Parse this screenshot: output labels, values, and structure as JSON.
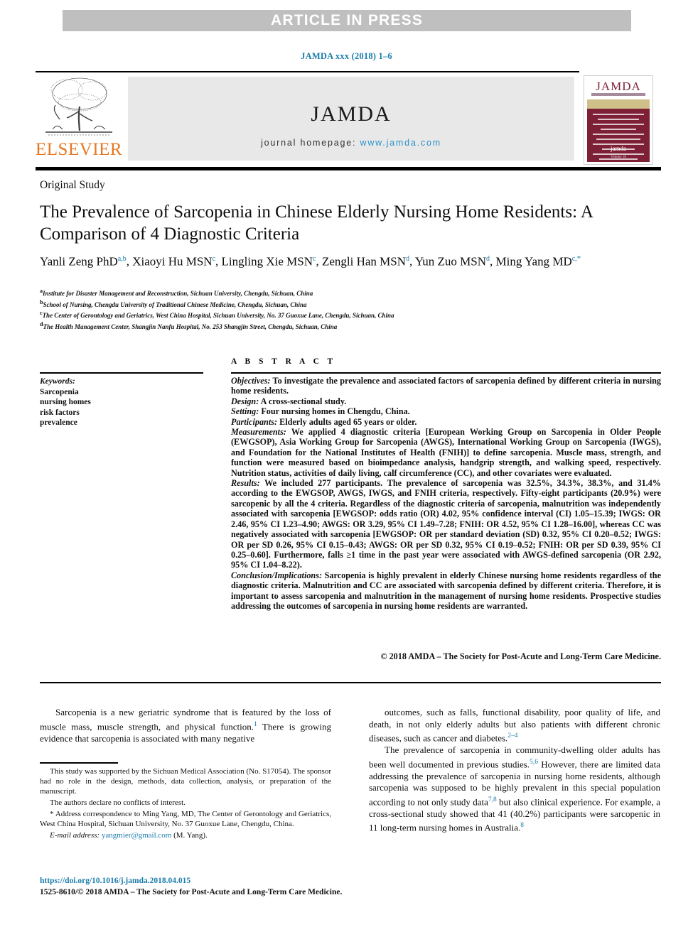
{
  "banner": {
    "text": "ARTICLE IN PRESS",
    "bg_color": "#bfbfbf",
    "text_color": "#ffffff"
  },
  "citation": {
    "text": "JAMDA xxx (2018) 1–6",
    "color": "#1a7cab"
  },
  "masthead": {
    "publisher_name": "ELSEVIER",
    "publisher_color": "#e87722",
    "journal_wordmark": "JAMDA",
    "homepage_label": "journal homepage:",
    "homepage_url": "www.jamda.com",
    "homepage_url_color": "#2a93c9",
    "cover": {
      "title": "JAMDA",
      "logo_text": "jamda",
      "foot_text": "Volume 18",
      "cover_color": "#7d1f35",
      "band_color": "#cfc089"
    }
  },
  "article": {
    "section_label": "Original Study",
    "title": "The Prevalence of Sarcopenia in Chinese Elderly Nursing Home Residents: A Comparison of 4 Diagnostic Criteria",
    "authors": [
      {
        "name": "Yanli Zeng PhD",
        "marks": "a,b",
        "sep": ", "
      },
      {
        "name": "Xiaoyi Hu MSN",
        "marks": "c",
        "sep": ", "
      },
      {
        "name": "Lingling Xie MSN",
        "marks": "c",
        "sep": ", "
      },
      {
        "name": "Zengli Han MSN",
        "marks": "d",
        "sep": ", "
      },
      {
        "name": "Yun Zuo MSN",
        "marks": "d",
        "sep": ", "
      },
      {
        "name": "Ming Yang MD",
        "marks": "c,",
        "star": "*",
        "sep": ""
      }
    ],
    "affiliations": [
      {
        "mark": "a",
        "text": "Institute for Disaster Management and Reconstruction, Sichuan University, Chengdu, Sichuan, China"
      },
      {
        "mark": "b",
        "text": "School of Nursing, Chengdu University of Traditional Chinese Medicine, Chengdu, Sichuan, China"
      },
      {
        "mark": "c",
        "text": "The Center of Gerontology and Geriatrics, West China Hospital, Sichuan University, No. 37 Guoxue Lane, Chengdu, Sichuan, China"
      },
      {
        "mark": "d",
        "text": "The Health Management Center, Shangjin Nanfu Hospital, No. 253 Shangjin Street, Chengdu, Sichuan, China"
      }
    ]
  },
  "keywords": {
    "heading": "Keywords:",
    "items": [
      "Sarcopenia",
      "nursing homes",
      "risk factors",
      "prevalence"
    ]
  },
  "abstract": {
    "heading": "A B S T R A C T",
    "sections": [
      {
        "label": "Objectives:",
        "text": " To investigate the prevalence and associated factors of sarcopenia defined by different criteria in nursing home residents."
      },
      {
        "label": "Design:",
        "text": " A cross-sectional study."
      },
      {
        "label": "Setting:",
        "text": " Four nursing homes in Chengdu, China."
      },
      {
        "label": "Participants:",
        "text": " Elderly adults aged 65 years or older."
      },
      {
        "label": "Measurements:",
        "text": " We applied 4 diagnostic criteria [European Working Group on Sarcopenia in Older People (EWGSOP), Asia Working Group for Sarcopenia (AWGS), International Working Group on Sarcopenia (IWGS), and Foundation for the National Institutes of Health (FNIH)] to define sarcopenia. Muscle mass, strength, and function were measured based on bioimpedance analysis, handgrip strength, and walking speed, respectively. Nutrition status, activities of daily living, calf circumference (CC), and other covariates were evaluated."
      },
      {
        "label": "Results:",
        "text": " We included 277 participants. The prevalence of sarcopenia was 32.5%, 34.3%, 38.3%, and 31.4% according to the EWGSOP, AWGS, IWGS, and FNIH criteria, respectively. Fifty-eight participants (20.9%) were sarcopenic by all the 4 criteria. Regardless of the diagnostic criteria of sarcopenia, malnutrition was independently associated with sarcopenia [EWGSOP: odds ratio (OR) 4.02, 95% confidence interval (CI) 1.05–15.39; IWGS: OR 2.46, 95% CI 1.23–4.90; AWGS: OR 3.29, 95% CI 1.49–7.28; FNIH: OR 4.52, 95% CI 1.28–16.00], whereas CC was negatively associated with sarcopenia [EWGSOP: OR per standard deviation (SD) 0.32, 95% CI 0.20–0.52; IWGS: OR per SD 0.26, 95% CI 0.15–0.43; AWGS: OR per SD 0.32, 95% CI 0.19–0.52; FNIH: OR per SD 0.39, 95% CI 0.25–0.60]. Furthermore, falls ≥1 time in the past year were associated with AWGS-defined sarcopenia (OR 2.92, 95% CI 1.04–8.22)."
      },
      {
        "label": "Conclusion/Implications:",
        "text": " Sarcopenia is highly prevalent in elderly Chinese nursing home residents regardless of the diagnostic criteria. Malnutrition and CC are associated with sarcopenia defined by different criteria. Therefore, it is important to assess sarcopenia and malnutrition in the management of nursing home residents. Prospective studies addressing the outcomes of sarcopenia in nursing home residents are warranted."
      }
    ],
    "copyright": "© 2018 AMDA – The Society for Post-Acute and Long-Term Care Medicine."
  },
  "body": {
    "left_column": [
      {
        "segments": [
          {
            "t": "Sarcopenia is a new geriatric syndrome that is featured by the loss of muscle mass, muscle strength, and physical function."
          },
          {
            "t": "1",
            "sup": true
          },
          {
            "t": " There is growing evidence that sarcopenia is associated with many negative"
          }
        ]
      }
    ],
    "right_column": [
      {
        "segments": [
          {
            "t": "outcomes, such as falls, functional disability, poor quality of life, and death, in not only elderly adults but also patients with different chronic diseases, such as cancer and diabetes."
          },
          {
            "t": "2–4",
            "sup": true
          }
        ]
      },
      {
        "segments": [
          {
            "t": "The prevalence of sarcopenia in community-dwelling older adults has been well documented in previous studies."
          },
          {
            "t": "5,6",
            "sup": true
          },
          {
            "t": " However, there are limited data addressing the prevalence of sarcopenia in nursing home residents, although sarcopenia was supposed to be highly prevalent in this special population according to not only study data"
          },
          {
            "t": "7,8",
            "sup": true
          },
          {
            "t": " but also clinical experience. For example, a cross-sectional study showed that 41 (40.2%) participants were sarcopenic in 11 long-term nursing homes in Australia."
          },
          {
            "t": "8",
            "sup": true
          }
        ]
      }
    ]
  },
  "footnotes": {
    "funding": "This study was supported by the Sichuan Medical Association (No. S17054). The sponsor had no role in the design, methods, data collection, analysis, or preparation of the manuscript.",
    "conflicts": "The authors declare no conflicts of interest.",
    "correspondence_star": "*",
    "correspondence": " Address correspondence to Ming Yang, MD, The Center of Gerontology and Geriatrics, West China Hospital, Sichuan University, No. 37 Guoxue Lane, Chengdu, China.",
    "email_label": "E-mail address:",
    "email": "yangmier@gmail.com",
    "email_suffix": " (M. Yang)."
  },
  "footer": {
    "doi": "https://doi.org/10.1016/j.jamda.2018.04.015",
    "issn": "1525-8610/© 2018 AMDA – The Society for Post-Acute and Long-Term Care Medicine.",
    "link_color": "#1a7cab"
  }
}
